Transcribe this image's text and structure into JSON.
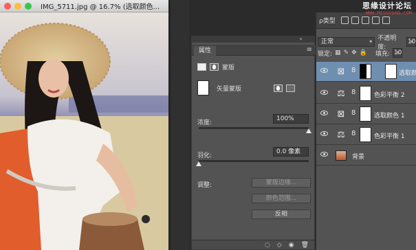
{
  "watermark": {
    "brand": "思缘设计论坛",
    "url": "WWW.MISSYUAN.COM"
  },
  "document": {
    "title": "IMG_5711.jpg @ 16.7% (选取颜色...",
    "colors": {
      "close": "#fc605b",
      "minimize": "#fdbc40",
      "zoom": "#34c84a"
    }
  },
  "properties": {
    "tab": "属性",
    "collapse_glyph": "«",
    "section_title": "蒙版",
    "mask_type": "矢量蒙版",
    "density_label": "浓度:",
    "density_value": "100%",
    "density_fraction": 1.0,
    "feather_label": "羽化:",
    "feather_value": "0.0 像素",
    "feather_fraction": 0.0,
    "adjust_label": "调整:",
    "buttons": [
      "蒙版边缘...",
      "颜色范围...",
      "反相"
    ],
    "footer_icons": [
      "selection-icon",
      "apply-icon",
      "visibility-icon",
      "trash-icon"
    ]
  },
  "layers": {
    "filter_kind": "ρ类型",
    "blend_mode": "正常",
    "opacity_label": "不透明度:",
    "opacity_value": "10",
    "lock_label": "锁定:",
    "fill_label": "填充:",
    "fill_value": "10",
    "items": [
      {
        "name": "选取颜色",
        "icon": "selective-color-icon",
        "selected": true
      },
      {
        "name": "色彩平衡 2",
        "icon": "balance-icon",
        "selected": false
      },
      {
        "name": "选取颜色 1",
        "icon": "selective-color-icon",
        "selected": false
      },
      {
        "name": "色彩平衡 1",
        "icon": "balance-icon",
        "selected": false
      },
      {
        "name": "背景",
        "icon": "image-icon",
        "selected": false
      }
    ],
    "colors": {
      "selected": "#6f8fb0"
    }
  }
}
